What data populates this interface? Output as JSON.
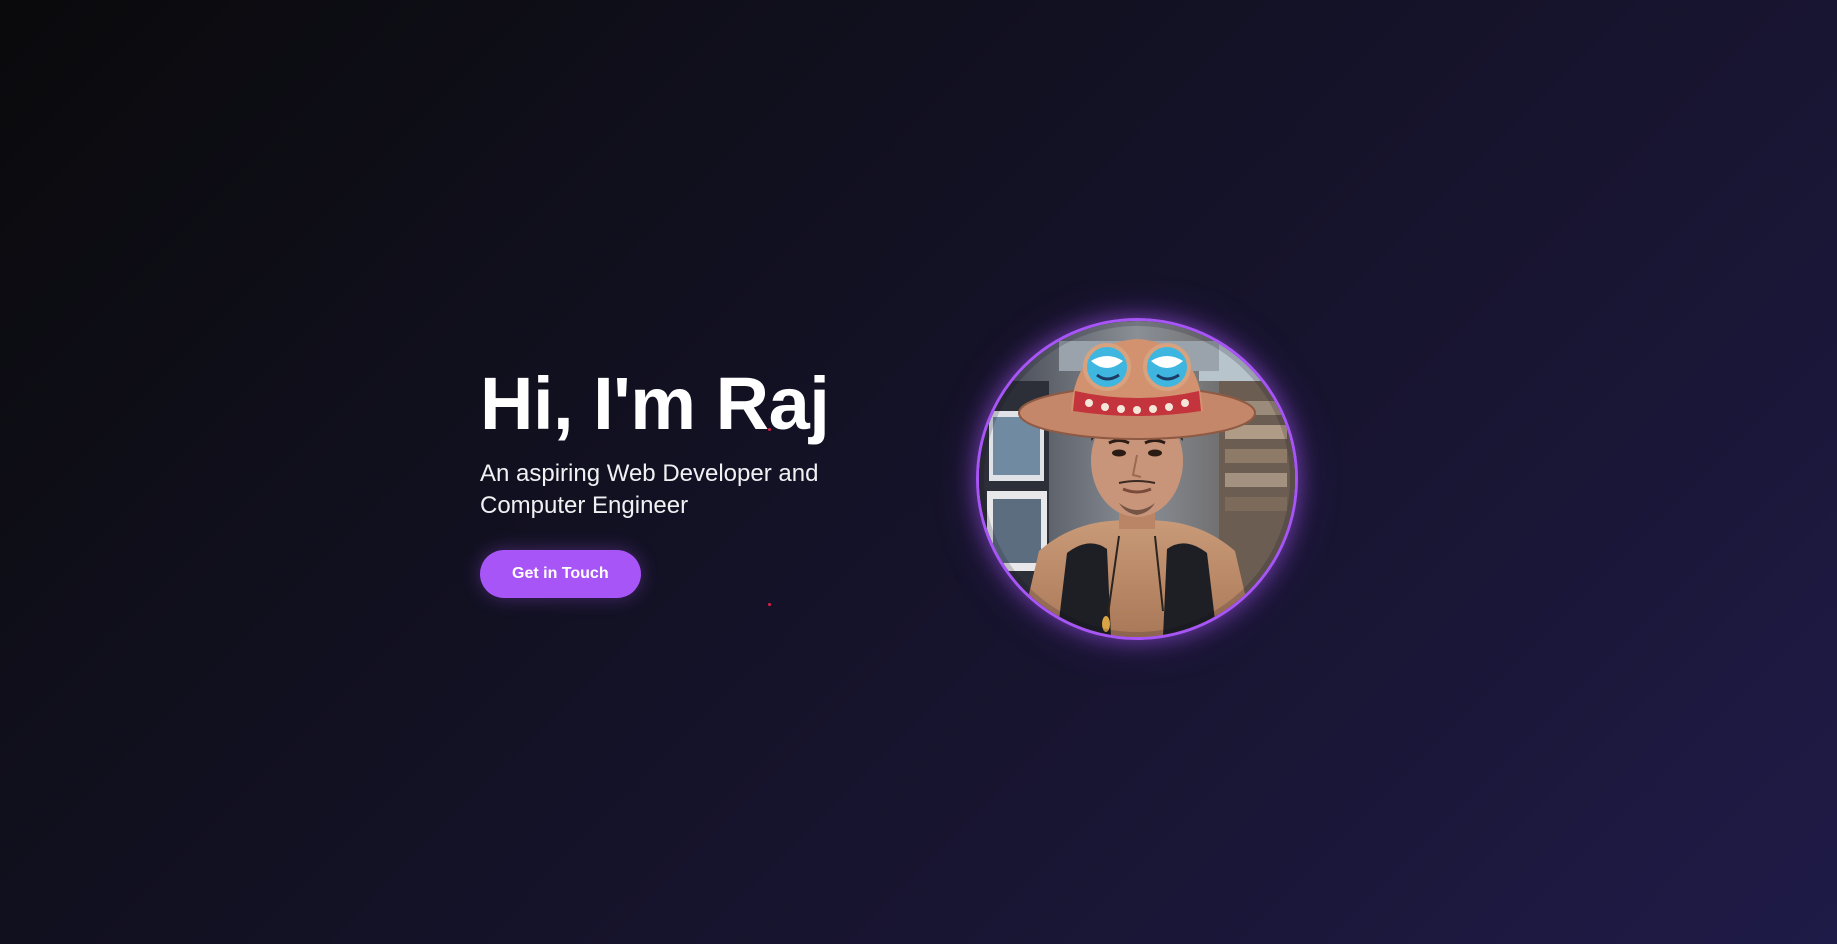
{
  "hero": {
    "headline": "Hi, I'm Raj",
    "tagline": "An aspiring Web Developer and Computer Engineer",
    "cta_label": "Get in Touch",
    "accent_color": "#a855f7",
    "profile_photo": "profile-photo"
  }
}
